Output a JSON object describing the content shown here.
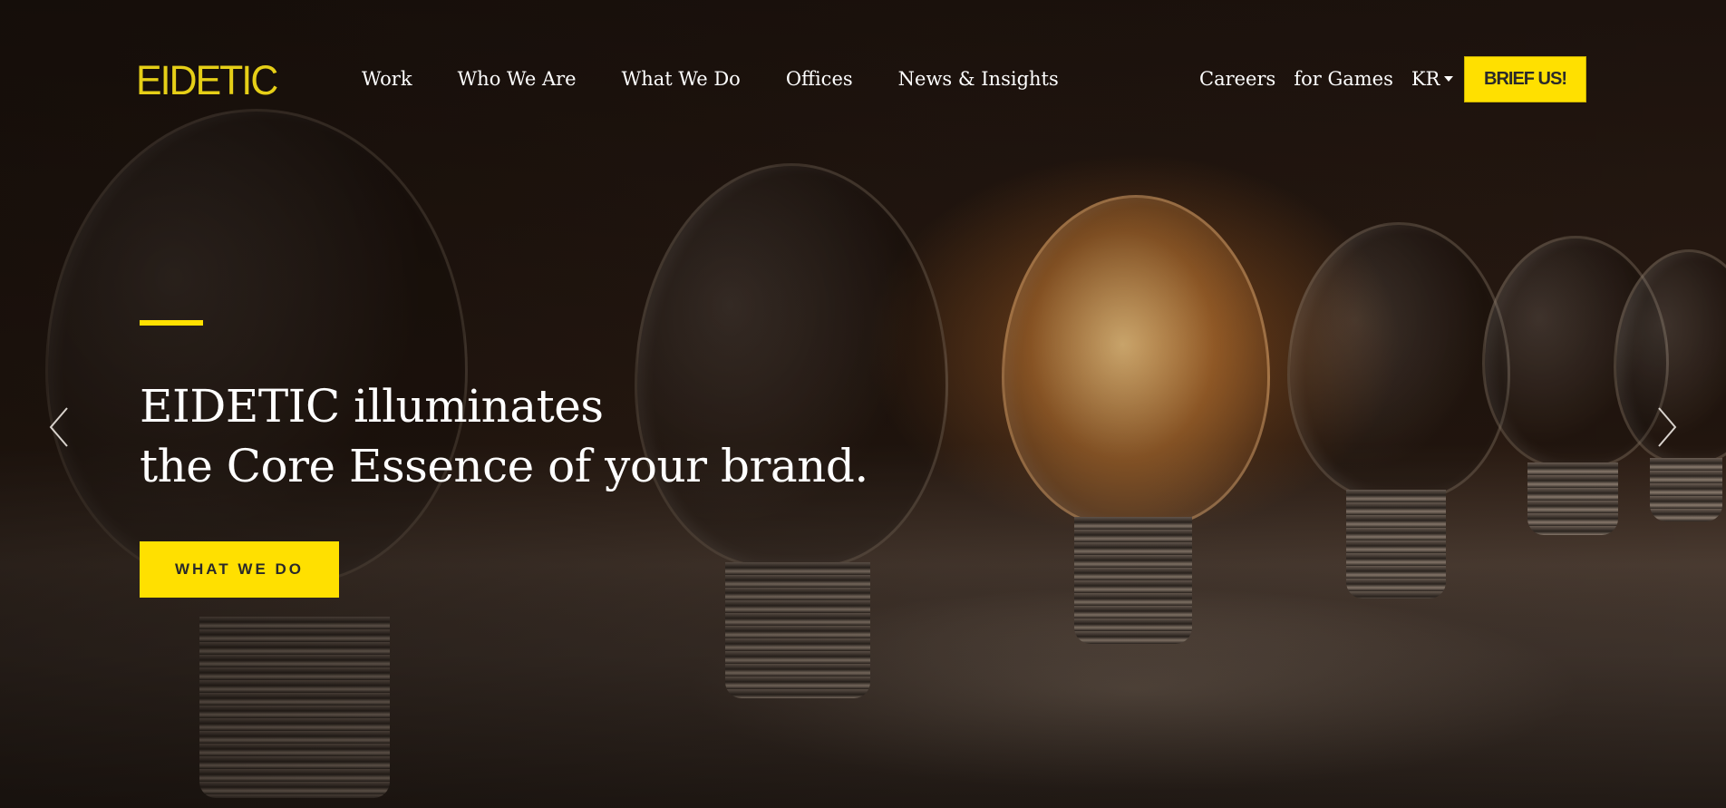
{
  "header": {
    "logo_text": "EIDETIC",
    "nav_main": [
      {
        "label": "Work"
      },
      {
        "label": "Who We Are"
      },
      {
        "label": "What We Do"
      },
      {
        "label": "Offices"
      },
      {
        "label": "News & Insights"
      }
    ],
    "nav_right": {
      "careers": "Careers",
      "games": "for Games",
      "language": "KR",
      "brief_button": "BRIEF US!"
    }
  },
  "hero": {
    "headline_line1": "EIDETIC illuminates",
    "headline_line2": "the Core Essence of your brand.",
    "cta_label": "WHAT WE DO",
    "background_subject": "light bulbs",
    "prev_icon": "chevron-left-icon",
    "next_icon": "chevron-right-icon"
  },
  "colors": {
    "accent": "#ffe000",
    "text": "#ffffff",
    "logo": "#e6cf17",
    "background": "#1a120d"
  }
}
